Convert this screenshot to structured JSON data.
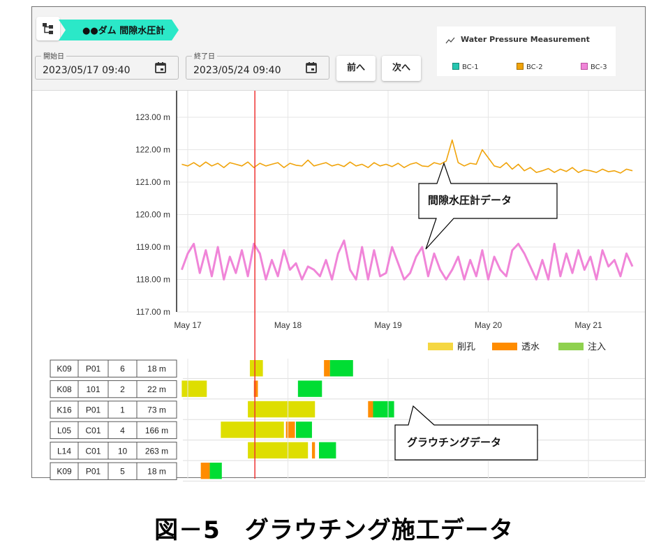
{
  "toolbar": {
    "dam_name": "●●ダム 間隙水圧計",
    "start_label": "開始日",
    "start_value": "2023/05/17 09:40",
    "end_label": "終了日",
    "end_value": "2023/05/24 09:40",
    "prev_label": "前へ",
    "next_label": "次へ",
    "icons": [
      "tree-icon",
      "calendar-icon",
      "calendar-icon"
    ]
  },
  "legend": {
    "title": "Water Pressure Measurement",
    "items": [
      {
        "label": "BC-1",
        "color": "#26c6b0"
      },
      {
        "label": "BC-2",
        "color": "#f0a30a"
      },
      {
        "label": "BC-3",
        "color": "#f085d8"
      }
    ]
  },
  "callouts": {
    "pressure": "間隙水圧計データ",
    "grouting": "グラウチングデータ"
  },
  "grout_legend": [
    {
      "label": "削孔",
      "color": "#f5d742"
    },
    {
      "label": "透水",
      "color": "#ff8c00"
    },
    {
      "label": "注入",
      "color": "#8fd14f"
    }
  ],
  "grout_rows": [
    {
      "c1": "K09",
      "c2": "P01",
      "c3": "6",
      "c4": "18 m"
    },
    {
      "c1": "K08",
      "c2": "101",
      "c3": "2",
      "c4": "22 m"
    },
    {
      "c1": "K16",
      "c2": "P01",
      "c3": "1",
      "c4": "73 m"
    },
    {
      "c1": "L05",
      "c2": "C01",
      "c3": "4",
      "c4": "166 m"
    },
    {
      "c1": "L14",
      "c2": "C01",
      "c3": "10",
      "c4": "263 m"
    },
    {
      "c1": "K09",
      "c2": "P01",
      "c3": "5",
      "c4": "18 m"
    }
  ],
  "grout_segments": [
    [
      {
        "s": 17.62,
        "e": 17.75,
        "t": "drill"
      },
      {
        "s": 18.36,
        "e": 18.42,
        "t": "perm"
      },
      {
        "s": 18.42,
        "e": 18.65,
        "t": "inject"
      }
    ],
    [
      {
        "s": 16.94,
        "e": 17.19,
        "t": "drill"
      },
      {
        "s": 17.66,
        "e": 17.7,
        "t": "perm"
      },
      {
        "s": 18.1,
        "e": 18.34,
        "t": "inject"
      }
    ],
    [
      {
        "s": 17.6,
        "e": 18.27,
        "t": "drill"
      },
      {
        "s": 18.8,
        "e": 18.85,
        "t": "perm"
      },
      {
        "s": 18.85,
        "e": 19.06,
        "t": "inject"
      }
    ],
    [
      {
        "s": 17.33,
        "e": 17.96,
        "t": "drill"
      },
      {
        "s": 17.98,
        "e": 18.07,
        "t": "perm"
      },
      {
        "s": 18.08,
        "e": 18.24,
        "t": "inject"
      }
    ],
    [
      {
        "s": 17.6,
        "e": 18.2,
        "t": "drill"
      },
      {
        "s": 18.24,
        "e": 18.27,
        "t": "perm"
      },
      {
        "s": 18.31,
        "e": 18.48,
        "t": "inject"
      }
    ],
    [
      {
        "s": 17.13,
        "e": 17.22,
        "t": "perm"
      },
      {
        "s": 17.22,
        "e": 17.34,
        "t": "inject"
      }
    ]
  ],
  "chart_data": {
    "type": "line",
    "ylim": [
      117,
      123.5
    ],
    "xlim": [
      "May 16 18:00",
      "May 21 18:00"
    ],
    "y_ticks": [
      "123.00 m",
      "122.00 m",
      "121.00 m",
      "120.00 m",
      "119.00 m",
      "118.00 m",
      "117.00 m"
    ],
    "y_tick_values": [
      123,
      122,
      121,
      120,
      119,
      118,
      117
    ],
    "x_ticks": [
      "May 17",
      "May 18",
      "May 19",
      "May 20",
      "May 21"
    ],
    "x_tick_values": [
      17,
      18,
      19,
      20,
      21
    ],
    "cursor_x": 17.67,
    "grid": true,
    "series": [
      {
        "name": "BC-1",
        "color": "#26c6b0",
        "x": [],
        "y": []
      },
      {
        "name": "BC-2",
        "color": "#f0a30a",
        "x": [
          16.94,
          17.0,
          17.06,
          17.12,
          17.18,
          17.24,
          17.3,
          17.36,
          17.42,
          17.48,
          17.54,
          17.6,
          17.66,
          17.72,
          17.78,
          17.84,
          17.9,
          17.96,
          18.02,
          18.08,
          18.14,
          18.2,
          18.26,
          18.32,
          18.38,
          18.44,
          18.5,
          18.56,
          18.62,
          18.68,
          18.74,
          18.8,
          18.86,
          18.92,
          18.98,
          19.04,
          19.1,
          19.16,
          19.22,
          19.28,
          19.34,
          19.4,
          19.46,
          19.52,
          19.58,
          19.64,
          19.7,
          19.76,
          19.82,
          19.88,
          19.94,
          20.0,
          20.06,
          20.12,
          20.18,
          20.24,
          20.3,
          20.36,
          20.42,
          20.48,
          20.54,
          20.6,
          20.66,
          20.72,
          20.78,
          20.84,
          20.9,
          20.96,
          21.02,
          21.08,
          21.14,
          21.2,
          21.26,
          21.32,
          21.38,
          21.44
        ],
        "y": [
          121.55,
          121.5,
          121.6,
          121.48,
          121.62,
          121.5,
          121.58,
          121.45,
          121.6,
          121.55,
          121.5,
          121.62,
          121.45,
          121.58,
          121.5,
          121.55,
          121.6,
          121.45,
          121.58,
          121.52,
          121.5,
          121.68,
          121.5,
          121.55,
          121.6,
          121.5,
          121.55,
          121.48,
          121.62,
          121.5,
          121.55,
          121.45,
          121.6,
          121.5,
          121.55,
          121.48,
          121.58,
          121.45,
          121.55,
          121.6,
          121.5,
          121.48,
          121.6,
          121.55,
          121.65,
          122.3,
          121.6,
          121.5,
          121.58,
          121.55,
          122.0,
          121.75,
          121.5,
          121.45,
          121.6,
          121.4,
          121.55,
          121.35,
          121.45,
          121.3,
          121.35,
          121.42,
          121.3,
          121.4,
          121.33,
          121.45,
          121.3,
          121.38,
          121.35,
          121.3,
          121.4,
          121.32,
          121.35,
          121.28,
          121.4,
          121.35
        ]
      },
      {
        "name": "BC-3",
        "color": "#f085d8",
        "x": [
          16.94,
          17.0,
          17.06,
          17.12,
          17.18,
          17.24,
          17.3,
          17.36,
          17.42,
          17.48,
          17.54,
          17.6,
          17.66,
          17.72,
          17.78,
          17.84,
          17.9,
          17.96,
          18.02,
          18.08,
          18.14,
          18.2,
          18.26,
          18.32,
          18.38,
          18.44,
          18.5,
          18.56,
          18.62,
          18.68,
          18.74,
          18.8,
          18.86,
          18.92,
          18.98,
          19.04,
          19.1,
          19.16,
          19.22,
          19.28,
          19.34,
          19.4,
          19.46,
          19.52,
          19.58,
          19.64,
          19.7,
          19.76,
          19.82,
          19.88,
          19.94,
          20.0,
          20.06,
          20.12,
          20.18,
          20.24,
          20.3,
          20.36,
          20.42,
          20.48,
          20.54,
          20.6,
          20.66,
          20.72,
          20.78,
          20.84,
          20.9,
          20.96,
          21.02,
          21.08,
          21.14,
          21.2,
          21.26,
          21.32,
          21.38,
          21.44
        ],
        "y": [
          118.3,
          118.8,
          119.1,
          118.2,
          118.9,
          118.1,
          119.0,
          118.0,
          118.7,
          118.2,
          118.9,
          118.1,
          119.1,
          118.8,
          118.0,
          118.6,
          118.1,
          118.9,
          118.3,
          118.5,
          118.0,
          118.4,
          118.3,
          118.1,
          118.6,
          118.0,
          118.8,
          119.2,
          118.3,
          118.0,
          119.0,
          118.0,
          118.9,
          118.1,
          118.2,
          119.0,
          118.5,
          118.0,
          118.2,
          118.7,
          119.0,
          118.1,
          118.8,
          118.3,
          118.0,
          118.3,
          118.7,
          118.0,
          118.6,
          118.1,
          118.9,
          118.0,
          118.7,
          118.3,
          118.1,
          118.9,
          119.1,
          118.8,
          118.4,
          118.0,
          118.6,
          118.0,
          119.1,
          118.1,
          118.8,
          118.2,
          118.9,
          118.3,
          118.7,
          118.0,
          118.9,
          118.4,
          118.6,
          118.1,
          118.8,
          118.4
        ]
      }
    ]
  },
  "caption": "図－5　グラウチング施工データ"
}
